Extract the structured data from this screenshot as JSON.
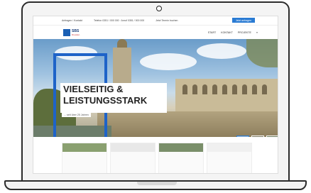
{
  "topbar": {
    "items": [
      "Anfragen / Kontakt",
      "Telefon 0351 / 000 000 · Anruf 0351 / 000 000",
      "Jetzt Termin buchen"
    ],
    "cta": "Jetzt anfragen"
  },
  "logo": {
    "name": "SBS",
    "subtitle": "Dresden"
  },
  "nav": {
    "items": [
      "START",
      "KONTAKT",
      "PROJEKTE",
      "≡"
    ]
  },
  "hero": {
    "headline_line1": "VIELSEITIG &",
    "headline_line2": "LEISTUNGSSTARK",
    "tagline": "... seit über 25 Jahren"
  },
  "colors": {
    "accent": "#1e63c8",
    "cta": "#2a7bd3"
  }
}
